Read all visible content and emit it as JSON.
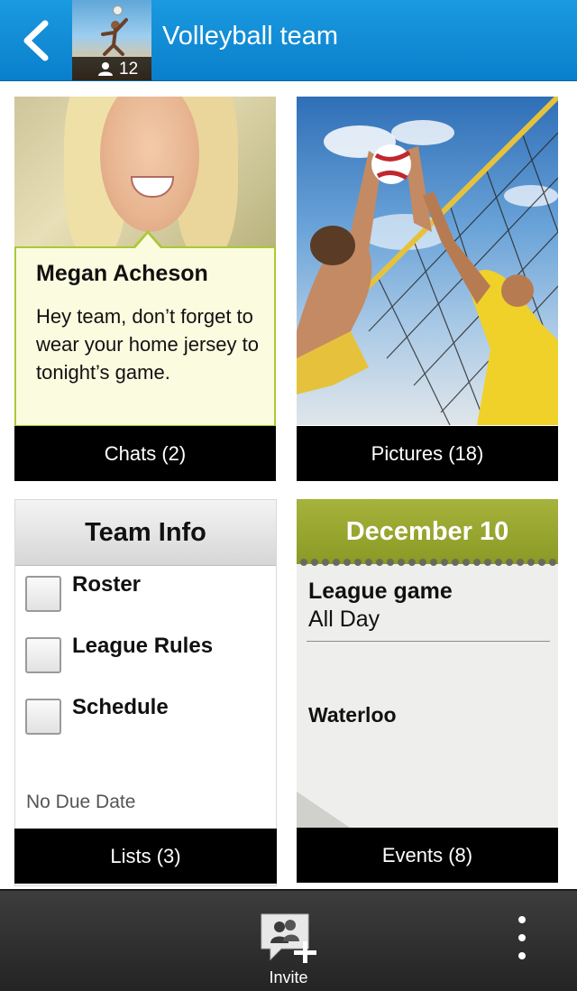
{
  "header": {
    "title": "Volleyball team",
    "member_count": "12",
    "back_icon": "chevron-left-icon",
    "background_color": "#0a8fdb"
  },
  "chats": {
    "sender": "Megan Acheson",
    "message": "Hey team, don’t forget to wear your home jersey to tonight’s game.",
    "label": "Chats (2)",
    "bubble_border_color": "#a9c936"
  },
  "pictures": {
    "label": "Pictures (18)"
  },
  "lists": {
    "heading": "Team Info",
    "items": [
      {
        "label": "Roster"
      },
      {
        "label": "League Rules"
      },
      {
        "label": "Schedule"
      }
    ],
    "due": "No Due Date",
    "label": "Lists (3)"
  },
  "events": {
    "date": "December 10",
    "title": "League game",
    "time": "All Day",
    "location": "Waterloo",
    "label": "Events (8)",
    "header_color": "#98a62f"
  },
  "bottom_bar": {
    "invite_label": "Invite",
    "invite_icon": "invite-contacts-icon",
    "overflow_icon": "overflow-menu-icon"
  }
}
